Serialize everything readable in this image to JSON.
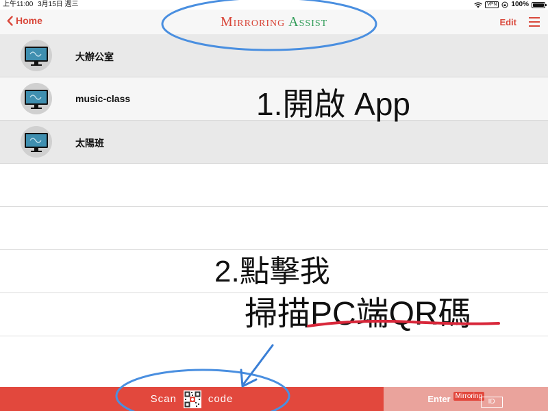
{
  "status_bar": {
    "time": "上午11:00",
    "date": "3月15日 週三",
    "vpn": "VPN",
    "battery": "100%"
  },
  "nav": {
    "back_label": "Home",
    "title_part1": "Mirroring",
    "title_part2": "Assist",
    "edit_label": "Edit"
  },
  "devices": [
    {
      "name": "大辦公室"
    },
    {
      "name": "music-class"
    },
    {
      "name": "太陽班"
    }
  ],
  "annotations": {
    "step1": "1.開啟 App",
    "step2_line1": "2.點擊我",
    "step2_line2": "掃描PC端QR碼"
  },
  "bottom": {
    "scan_left": "Scan",
    "scan_right": "code",
    "enter_label": "Enter",
    "mirroring_badge": "Mirroring",
    "id_label": "ID"
  },
  "colors": {
    "accent": "#d9473a",
    "assist_green": "#2e9b56",
    "scan_bar": "#e2483d",
    "enter_bar": "#eaa39c",
    "circle": "#4a8fe0",
    "underline": "#d8273a"
  }
}
